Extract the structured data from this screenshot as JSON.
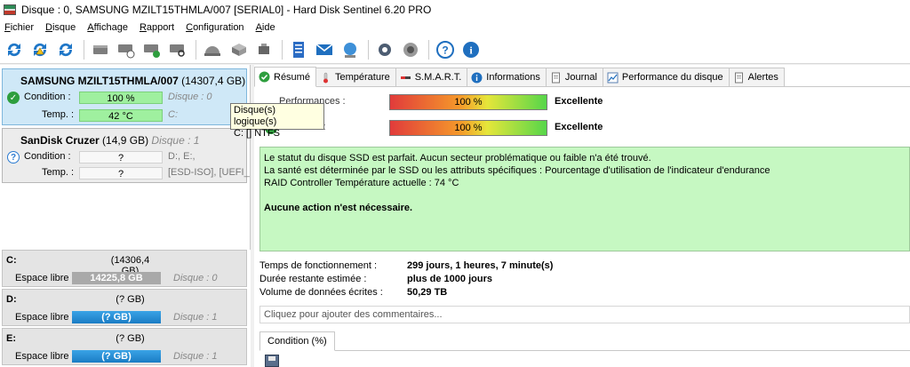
{
  "window": {
    "title": "Disque : 0, SAMSUNG MZILT15THMLA/007 [SERIAL0]  -  Hard Disk Sentinel 6.20 PRO"
  },
  "menu": [
    "Fichier",
    "Disque",
    "Affichage",
    "Rapport",
    "Configuration",
    "Aide"
  ],
  "disks": [
    {
      "name": "SAMSUNG MZILT15THMLA/007",
      "size": "(14307,4 GB)",
      "condition_label": "Condition :",
      "condition_value": "100 %",
      "condition_extra": "Disque : 0",
      "temp_label": "Temp. :",
      "temp_value": "42 °C",
      "temp_extra": "C:"
    },
    {
      "name": "SanDisk Cruzer",
      "size": "(14,9 GB)",
      "disk_num": "Disque : 1",
      "condition_label": "Condition :",
      "condition_value": "?",
      "condition_extra": "D:, E:,",
      "temp_label": "Temp. :",
      "temp_value": "?",
      "temp_extra": "[ESD-ISO],  [UEFI_"
    }
  ],
  "tooltip": {
    "line1": "Disque(s) logique(s)",
    "line2": "C: [] NTFS"
  },
  "volumes": [
    {
      "letter": "C:",
      "size": "(14306,4 GB)",
      "free_label": "Espace libre",
      "free": "14225,8 GB",
      "disk": "Disque : 0",
      "bar": "gray"
    },
    {
      "letter": "D:",
      "size": "(? GB)",
      "free_label": "Espace libre",
      "free": "(? GB)",
      "disk": "Disque : 1",
      "bar": "blue"
    },
    {
      "letter": "E:",
      "size": "(? GB)",
      "free_label": "Espace libre",
      "free": "(? GB)",
      "disk": "Disque : 1",
      "bar": "blue"
    }
  ],
  "tabs": [
    "Résumé",
    "Température",
    "S.M.A.R.T.",
    "Informations",
    "Journal",
    "Performance du disque",
    "Alertes"
  ],
  "summary": {
    "performance_label": "Performances :",
    "performance_value": "100 %",
    "performance_fraction": 1.0,
    "performance_text": "Excellente",
    "condition_label": "Condition :",
    "condition_value": "100 %",
    "condition_fraction": 1.0,
    "condition_text": "Excellente",
    "status_lines": [
      "Le statut du disque SSD est parfait. Aucun secteur problématique ou faible n'a été trouvé.",
      "La santé est déterminée par le SSD ou les attributs spécifiques : Pourcentage d'utilisation de l'indicateur d'endurance",
      "RAID Controller Température actuelle : 74 °C"
    ],
    "status_action": "Aucune action n'est nécessaire.",
    "info": [
      {
        "k": "Temps de fonctionnement :",
        "v": "299 jours, 1 heures, 7 minute(s)"
      },
      {
        "k": "Durée restante estimée :",
        "v": "plus de 1000 jours"
      },
      {
        "k": "Volume de données écrites :",
        "v": "50,29 TB"
      }
    ],
    "comments_placeholder": "Cliquez pour ajouter des commentaires...",
    "condition_tab": "Condition (%)"
  },
  "colors": {
    "selected_card": "#cfe8f7",
    "status_green": "#c6f8c2",
    "bar_green": "#9ff09f"
  }
}
